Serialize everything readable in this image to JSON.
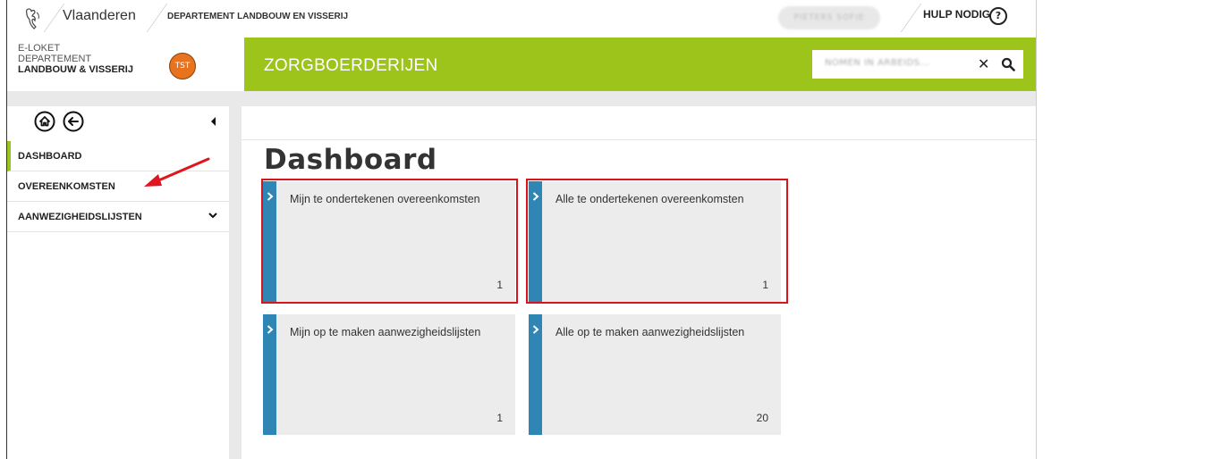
{
  "topbar": {
    "brand": "Vlaanderen",
    "department": "DEPARTEMENT LANDBOUW EN VISSERIJ",
    "user_name": "PIETERS SOFIE",
    "help_label": "HULP NODIG",
    "help_icon_glyph": "?"
  },
  "header": {
    "eloket_line1": "E-LOKET",
    "eloket_line2": "DEPARTEMENT",
    "eloket_line3": "LANDBOUW & VISSERIJ",
    "avatar_initials": "TST",
    "app_title": "ZORGBOERDERIJEN",
    "search_value": "NOMEN IN ARBEIDS...",
    "clear_glyph": "✕"
  },
  "sidebar": {
    "items": [
      {
        "label": "DASHBOARD",
        "active": true
      },
      {
        "label": "OVEREENKOMSTEN",
        "active": false
      },
      {
        "label": "AANWEZIGHEIDSLIJSTEN",
        "active": false,
        "expandable": true
      }
    ]
  },
  "main": {
    "title": "Dashboard",
    "tiles": [
      {
        "label": "Mijn te ondertekenen overeenkomsten",
        "count": "1",
        "highlighted": true
      },
      {
        "label": "Alle te ondertekenen overeenkomsten",
        "count": "1",
        "highlighted": true
      },
      {
        "label": "Mijn op te maken aanwezigheidslijsten",
        "count": "1",
        "highlighted": false
      },
      {
        "label": "Alle op te maken aanwezigheidslijsten",
        "count": "20",
        "highlighted": false
      }
    ]
  },
  "colors": {
    "brand_green": "#9dc41b",
    "tile_bar_blue": "#2f86b5",
    "avatar_orange": "#e8731f",
    "annotation_red": "#d8141c"
  }
}
